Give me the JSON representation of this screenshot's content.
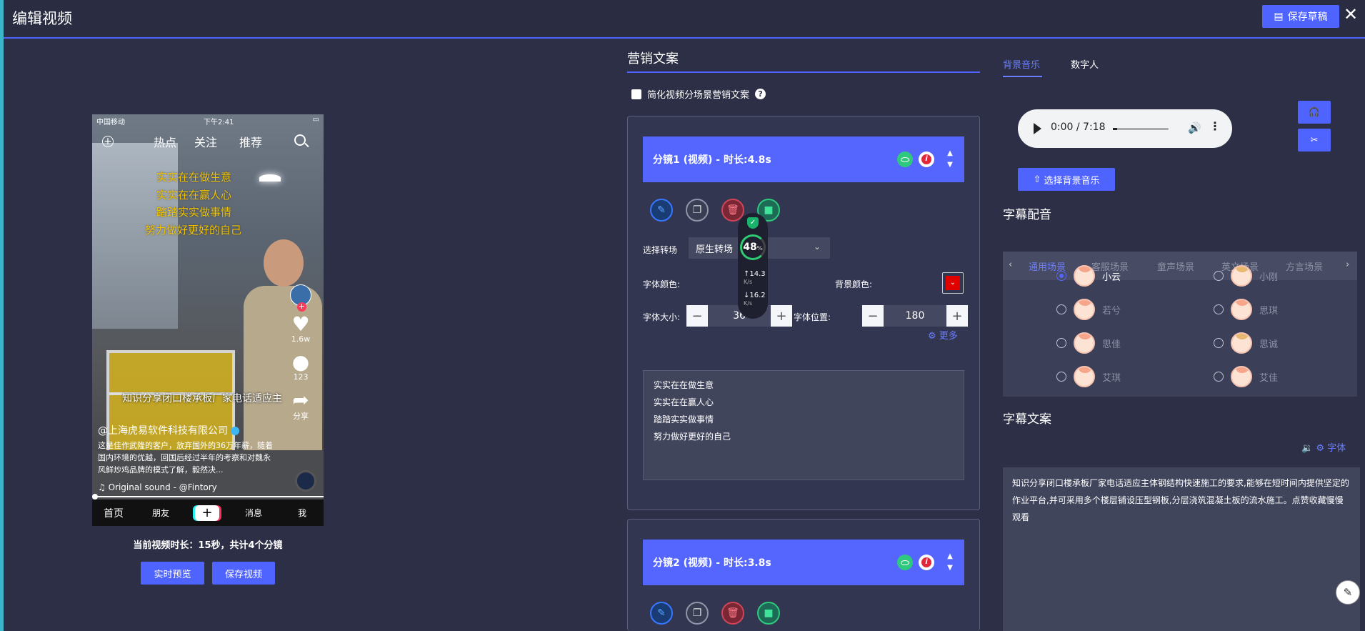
{
  "header": {
    "title": "编辑视频",
    "save_draft": "保存草稿",
    "close": "✕"
  },
  "phone": {
    "status_left": "中国移动",
    "status_time": "下午2:41",
    "nav": [
      "热点",
      "关注",
      "推荐"
    ],
    "yellow_lines": [
      "实实在在做生意",
      "实实在在赢人心",
      "踏踏实实做事情",
      "努力做好更好的自己"
    ],
    "likes": "1.6w",
    "comments": "123",
    "share": "分享",
    "subtitle": "知识分享闭口楼承板厂家电话适应主",
    "author": "@上海虎易软件科技有限公司",
    "desc": "这是佳作武隆的客户，放弃国外的36万年薪，随着国内环境的优越，回国后经过半年的考察和对魏永风鲜炒鸡品牌的模式了解，毅然决...",
    "sound": "♫ Original sound - @Fintory",
    "bottom_nav": [
      "首页",
      "朋友",
      "+",
      "消息",
      "我"
    ]
  },
  "preview_info": "当前视频时长：15秒，共计4个分镜",
  "buttons": {
    "realtime_preview": "实时预览",
    "save_video": "保存视频"
  },
  "marketing": {
    "title": "营销文案",
    "simplify_label": "简化视频分场景营销文案",
    "help": "?"
  },
  "shot1": {
    "title": "分镜1 (视频) - 时长:4.8s",
    "transition_label": "选择转场",
    "transition_value": "原生转场",
    "font_color_label": "字体颜色:",
    "bg_color_label": "背景颜色:",
    "font_size_label": "字体大小:",
    "font_size_value": "36",
    "font_pos_label": "字体位置:",
    "font_pos_value": "180",
    "more": "更多",
    "text_lines": [
      "实实在在做生意",
      "实实在在赢人心",
      "踏踏实实做事情",
      "努力做好更好的自己"
    ]
  },
  "shot2": {
    "title": "分镜2 (视频) - 时长:3.8s"
  },
  "net_widget": {
    "percent": "48",
    "percent_unit": "%",
    "up": "14.3",
    "down": "16.2",
    "unit": "K/s"
  },
  "right": {
    "tab_music": "背景音乐",
    "tab_avatar": "数字人",
    "audio_time": "0:00 / 7:18",
    "audio_progress": 0.0,
    "select_music": "选择背景音乐",
    "dubbing_title": "字幕配音",
    "scenes": [
      "通用场景",
      "客服场景",
      "童声场景",
      "英文场景",
      "方言场景"
    ],
    "voices_left": [
      "小云",
      "若兮",
      "思佳",
      "艾琪"
    ],
    "voices_right": [
      "小刚",
      "思琪",
      "思诚",
      "艾佳"
    ],
    "caption_title": "字幕文案",
    "font_tool": "字体",
    "caption_text": "知识分享闭口楼承板厂家电话适应主体钢结构快速施工的要求,能够在短时间内提供坚定的作业平台,并可采用多个楼层铺设压型钢板,分层浇筑混凝土板的流水施工。点赞收藏慢慢观看"
  }
}
